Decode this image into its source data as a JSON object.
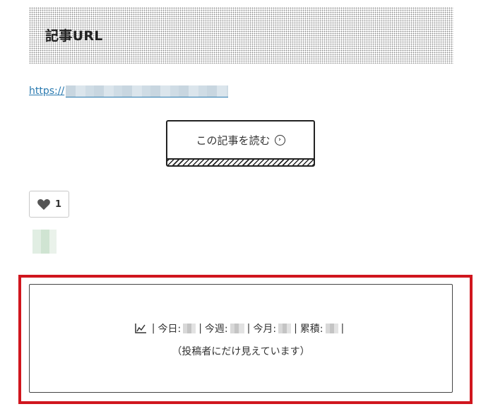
{
  "article": {
    "heading": "記事URL",
    "url_prefix": "https://",
    "read_button_label": "この記事を読む"
  },
  "likes": {
    "count": "1"
  },
  "stats": {
    "today_label": "今日:",
    "week_label": "今週:",
    "month_label": "今月:",
    "total_label": "累積:",
    "separator": "|",
    "note": "（投稿者にだけ見えています）"
  },
  "colors": {
    "highlight_border": "#d0161e",
    "link": "#2a7ab0"
  }
}
